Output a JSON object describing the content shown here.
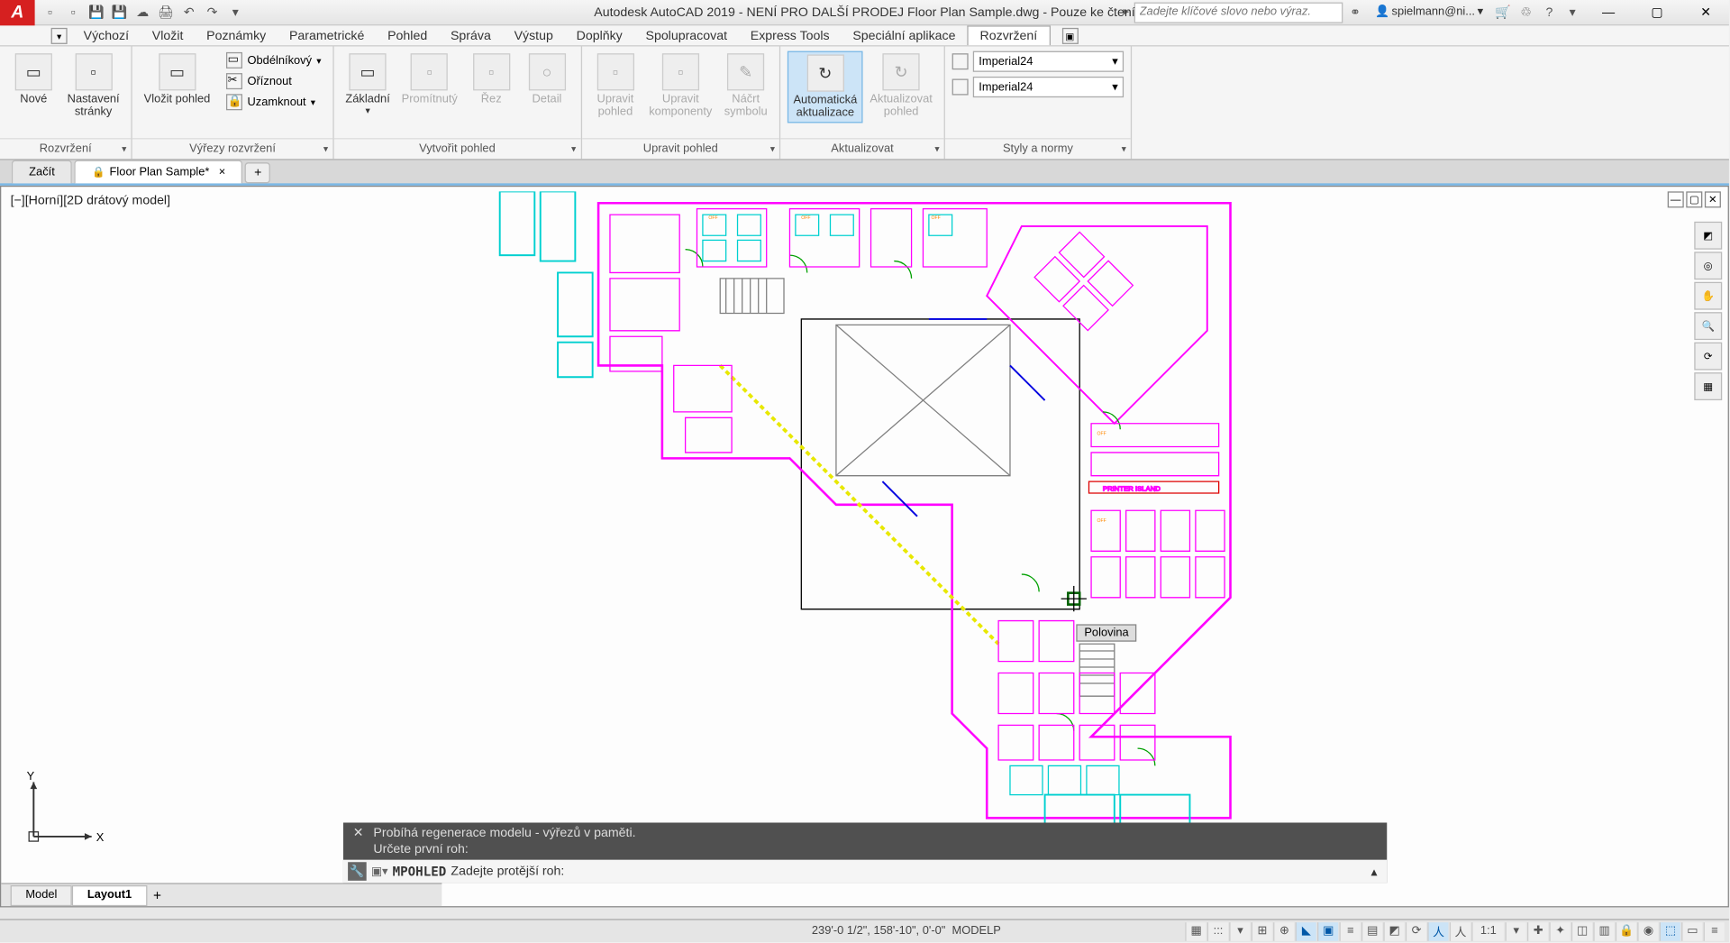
{
  "title": "Autodesk AutoCAD 2019 - NENÍ PRO DALŠÍ PRODEJ   Floor Plan Sample.dwg - Pouze ke čtení",
  "search_placeholder": "Zadejte klíčové slovo nebo výraz.",
  "account": "spielmann@ni...",
  "menus": [
    "Výchozí",
    "Vložit",
    "Poznámky",
    "Parametrické",
    "Pohled",
    "Správa",
    "Výstup",
    "Doplňky",
    "Spolupracovat",
    "Express Tools",
    "Speciální aplikace",
    "Rozvržení"
  ],
  "active_menu": 11,
  "ribbon": {
    "panels": [
      {
        "title": "Rozvržení",
        "items": [
          {
            "label": "Nové",
            "sub": "",
            "ico": "▭"
          },
          {
            "label": "Nastavení",
            "sub": "stránky",
            "ico": "▫"
          }
        ]
      },
      {
        "title": "Výřezy rozvržení",
        "items": [
          {
            "label": "Vložit pohled",
            "ico": "▭"
          }
        ],
        "side": [
          {
            "label": "Obdélníkový",
            "ico": "▭",
            "dd": true
          },
          {
            "label": "Oříznout",
            "ico": "✂"
          },
          {
            "label": "Uzamknout",
            "ico": "🔒",
            "dd": true
          }
        ]
      },
      {
        "title": "Vytvořit pohled",
        "items": [
          {
            "label": "Základní",
            "ico": "▭",
            "dd": true
          },
          {
            "label": "Promítnutý",
            "ico": "▫",
            "disabled": true
          },
          {
            "label": "Řez",
            "ico": "▫",
            "disabled": true
          },
          {
            "label": "Detail",
            "ico": "○",
            "disabled": true
          }
        ]
      },
      {
        "title": "Upravit pohled",
        "items": [
          {
            "label": "Upravit",
            "sub": "pohled",
            "ico": "▫",
            "disabled": true
          },
          {
            "label": "Upravit",
            "sub": "komponenty",
            "ico": "▫",
            "disabled": true
          },
          {
            "label": "Náčrt",
            "sub": "symbolu",
            "ico": "✎",
            "disabled": true
          }
        ]
      },
      {
        "title": "Aktualizovat",
        "items": [
          {
            "label": "Automatická",
            "sub": "aktualizace",
            "ico": "↻",
            "active": true
          },
          {
            "label": "Aktualizovat",
            "sub": "pohled",
            "ico": "↻",
            "disabled": true
          }
        ]
      },
      {
        "title": "Styly a normy",
        "styles": [
          "Imperial24",
          "Imperial24"
        ]
      }
    ]
  },
  "doctabs": [
    {
      "label": "Začít",
      "active": false
    },
    {
      "label": "Floor Plan Sample*",
      "active": true,
      "lock": true,
      "close": true
    }
  ],
  "viewport_label": "[−][Horní][2D drátový model]",
  "tooltip": "Polovina",
  "cmd_history": [
    "Probíhá regenerace modelu - výřezů v paměti.",
    "Určete první roh:"
  ],
  "cmd_prompt": "MPOHLED",
  "cmd_text": "Zadejte protější roh:",
  "layout_tabs": [
    {
      "label": "Model",
      "active": false
    },
    {
      "label": "Layout1",
      "active": true
    }
  ],
  "status_coords": "239'-0 1/2\", 158'-10\", 0'-0\"",
  "status_space": "MODELP",
  "status_scale": "1:1",
  "ucs": {
    "x": "X",
    "y": "Y"
  }
}
